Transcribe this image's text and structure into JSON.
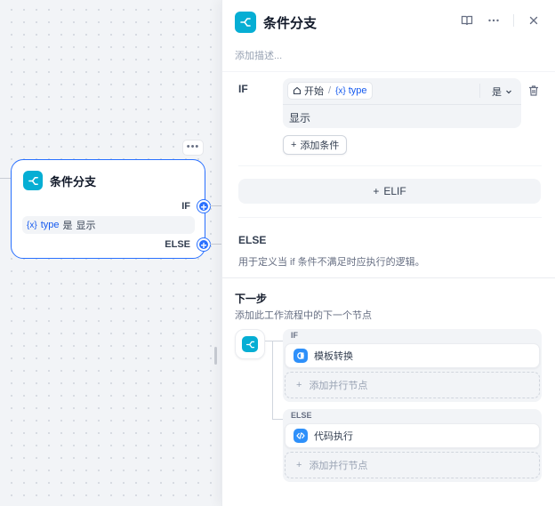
{
  "canvas": {
    "node": {
      "title": "条件分支",
      "icon": "branch-icon",
      "if_label": "IF",
      "else_label": "ELSE",
      "condition": {
        "var_badge": "{x}",
        "var_name": "type",
        "operator": "是",
        "value": "显示"
      },
      "more_label": "•••"
    }
  },
  "panel": {
    "title": "条件分支",
    "description_placeholder": "添加描述...",
    "tools": [
      "book-icon",
      "more-icon",
      "close-icon"
    ],
    "if_section": {
      "label": "IF",
      "var_source_icon": "home-icon",
      "var_source": "开始",
      "var_badge": "{x}",
      "var_name": "type",
      "operator": "是",
      "value": "显示",
      "add_condition_label": "添加条件"
    },
    "elif_label": "ELIF",
    "else_section": {
      "label": "ELSE",
      "description": "用于定义当 if 条件不满足时应执行的逻辑。"
    },
    "next_step": {
      "title": "下一步",
      "description": "添加此工作流程中的下一个节点",
      "branches": [
        {
          "label": "IF",
          "node_name": "模板转换",
          "node_icon": "template-icon",
          "add_parallel": "添加并行节点"
        },
        {
          "label": "ELSE",
          "node_name": "代码执行",
          "node_icon": "code-icon",
          "add_parallel": "添加并行节点"
        }
      ]
    }
  },
  "colors": {
    "accent": "#2970ff",
    "branch_icon_bg": "#06aed4",
    "node_icon_bg": "#2e90fa"
  }
}
